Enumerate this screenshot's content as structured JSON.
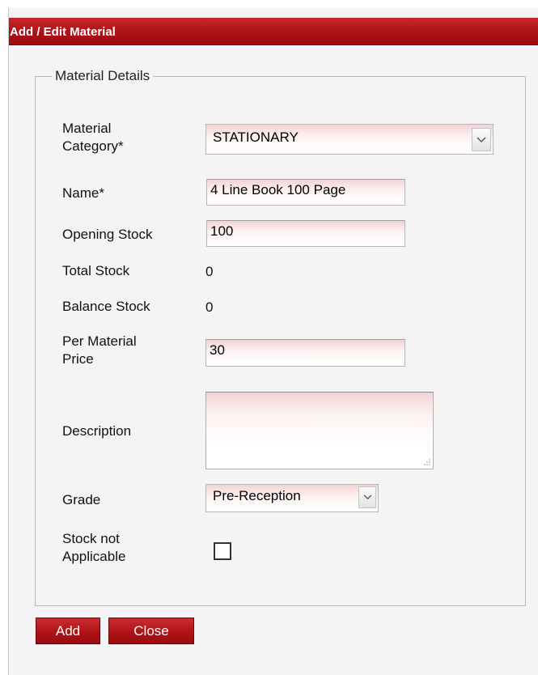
{
  "dialog": {
    "title": "Add / Edit Material"
  },
  "fieldset": {
    "legend": "Material Details"
  },
  "form": {
    "category_label_line1": "Material",
    "category_label_line2": "Category*",
    "category_value": "STATIONARY",
    "name_label": "Name*",
    "name_value": "4 Line Book 100 Page",
    "opening_stock_label": "Opening Stock",
    "opening_stock_value": "100",
    "total_stock_label": "Total Stock",
    "total_stock_value": "0",
    "balance_stock_label": "Balance Stock",
    "balance_stock_value": "0",
    "price_label_line1": "Per Material",
    "price_label_line2": "Price",
    "price_value": "30",
    "description_label": "Description",
    "description_value": "",
    "grade_label": "Grade",
    "grade_value": "Pre-Reception",
    "stock_na_label_line1": "Stock not",
    "stock_na_label_line2": "Applicable",
    "stock_na_checked": false
  },
  "buttons": {
    "add_label": "Add",
    "close_label": "Close"
  },
  "colors": {
    "titlebar": "#ad1216",
    "button": "#ae1418",
    "input_tint": "#f3d3d5"
  },
  "icons": {
    "select_arrow": "chevron-down-icon",
    "textarea_grip": "resize-grip-icon"
  }
}
